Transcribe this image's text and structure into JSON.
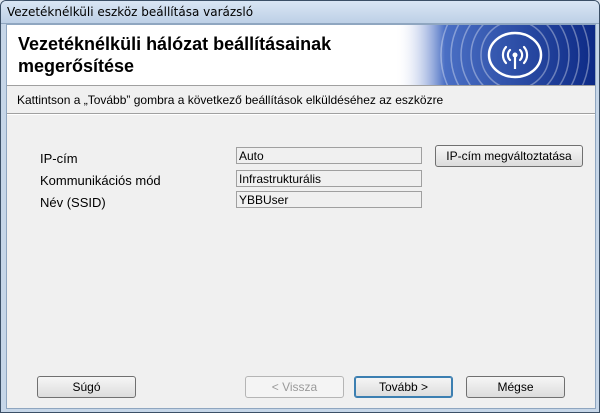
{
  "window": {
    "title": "Vezetéknélküli eszköz beállítása varázsló"
  },
  "banner": {
    "title": "Vezetéknélküli hálózat beállításainak megerősítése",
    "logo_icon": "wireless-signal-icon",
    "accent": "#1b3f9b"
  },
  "instruction": "Kattintson a „Tovább” gombra a következő beállítások elküldéséhez az eszközre",
  "settings": [
    {
      "label": "IP-cím",
      "value": "Auto"
    },
    {
      "label": "Kommunikációs mód",
      "value": "Infrastrukturális"
    },
    {
      "label": "Név (SSID)",
      "value": "YBBUser"
    }
  ],
  "buttons": {
    "change_ip": "IP-cím megváltoztatása",
    "help": "Súgó",
    "back": "< Vissza",
    "next": "Tovább >",
    "cancel": "Mégse"
  }
}
